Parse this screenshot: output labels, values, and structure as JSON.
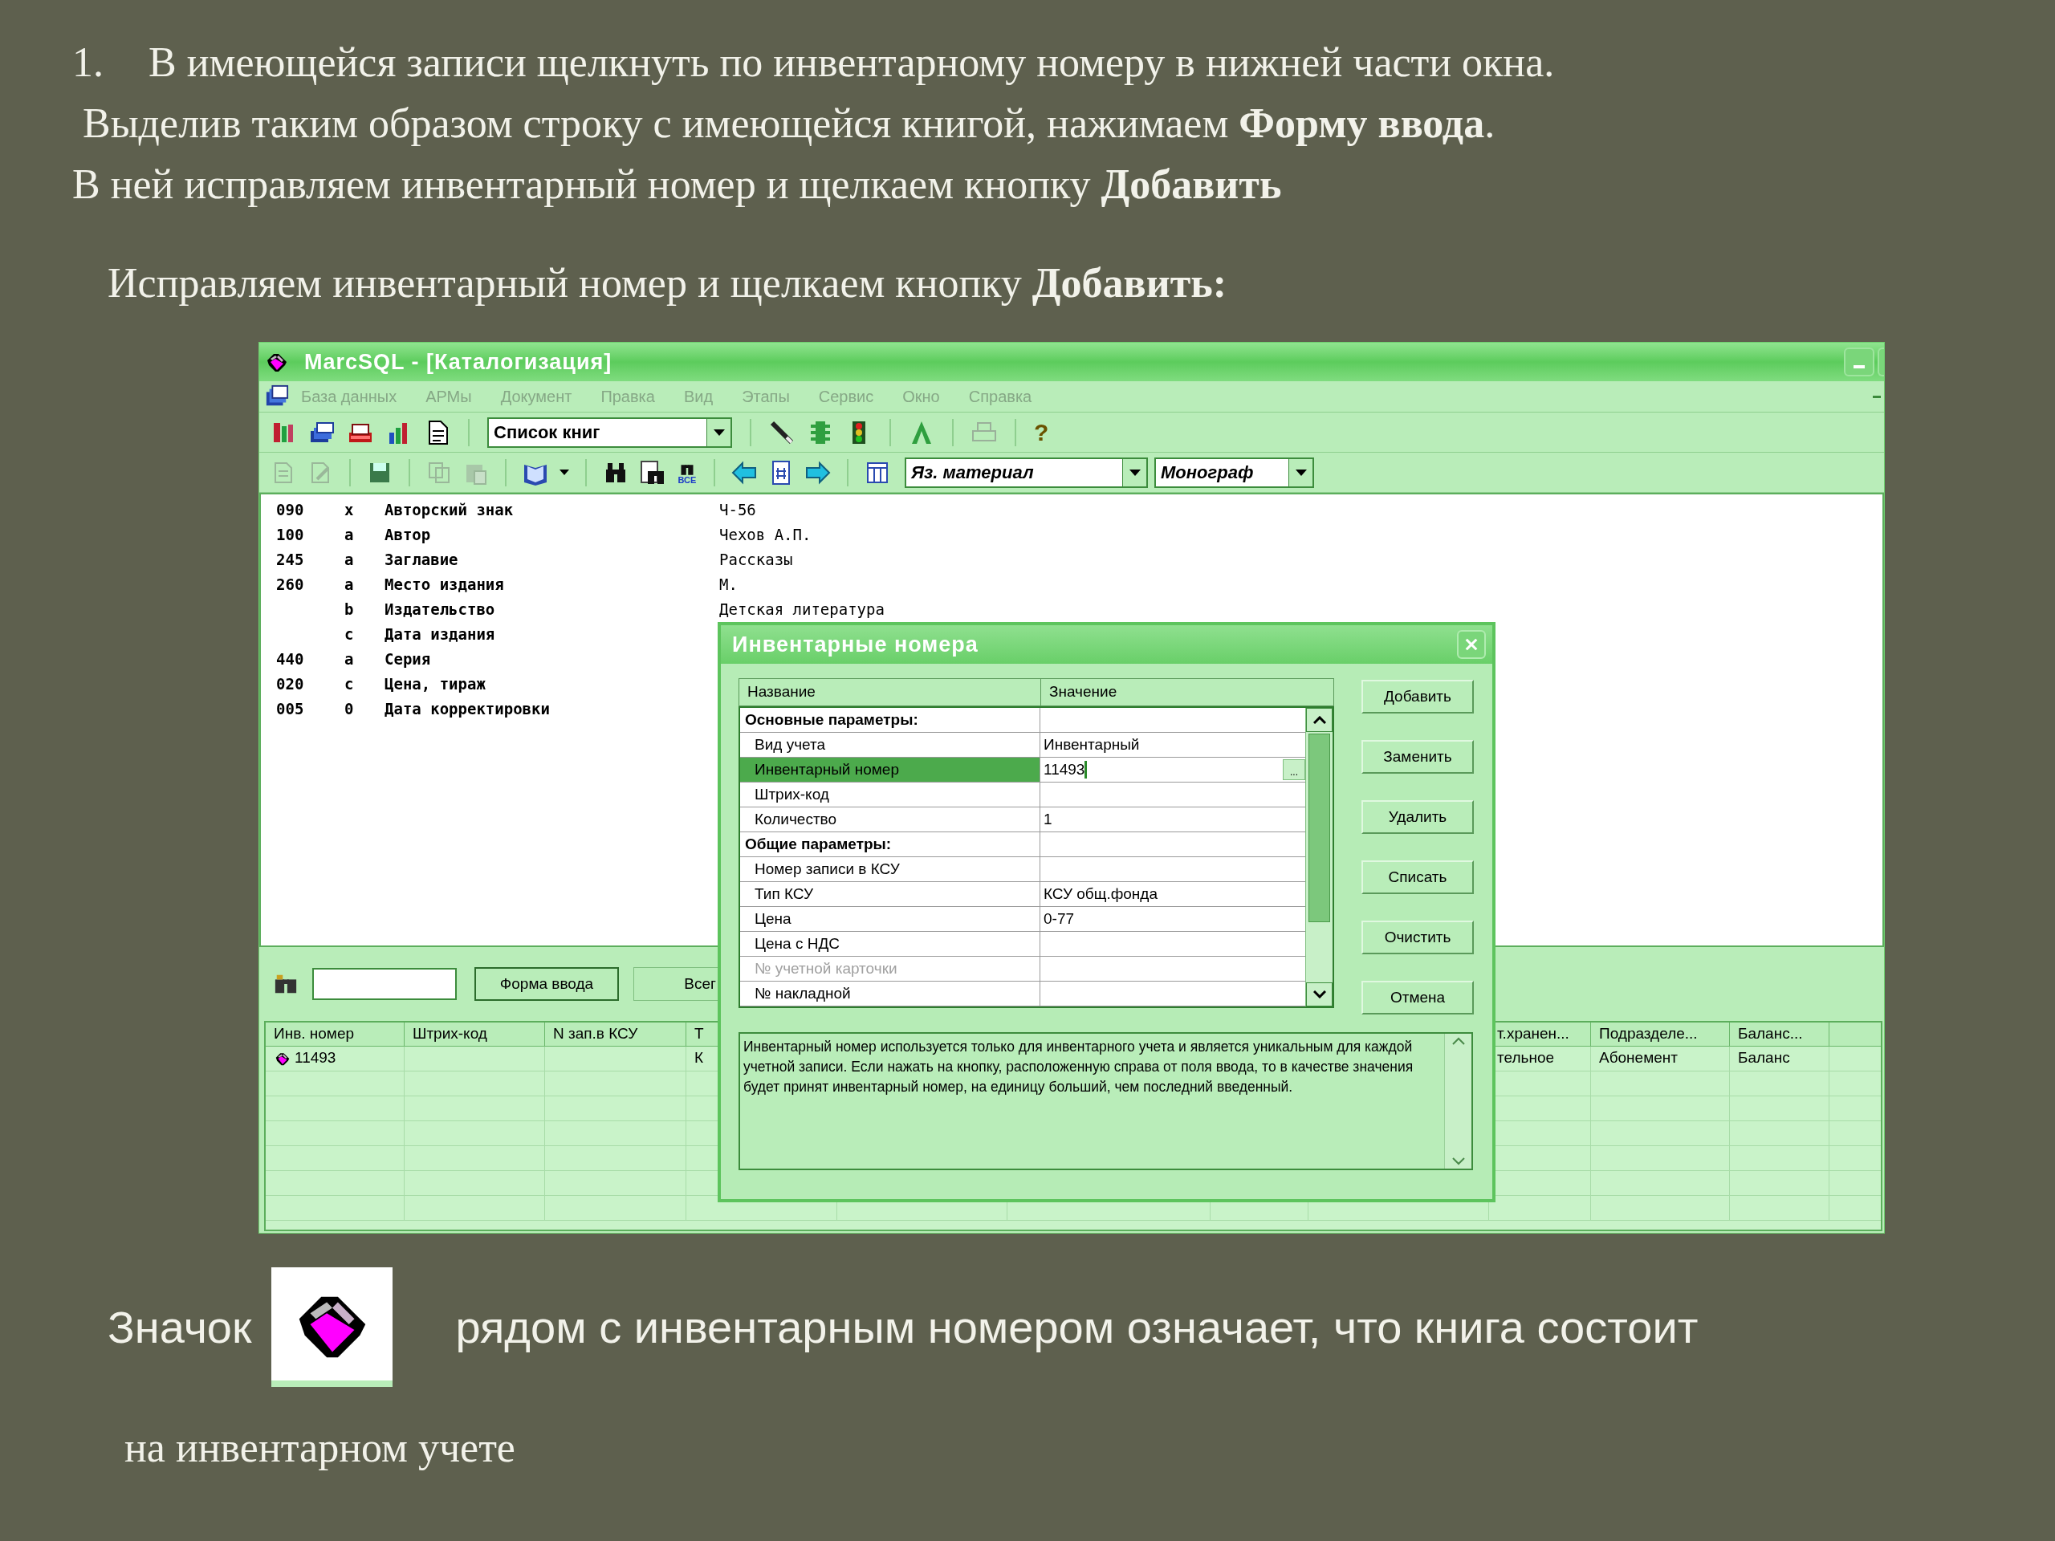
{
  "slide": {
    "step_number": "1.",
    "instructions": [
      "В имеющейся записи щелкнуть по инвентарному номеру в нижней части окна.",
      " Выделив таким образом строку с имеющейся книгой, нажимаем **Форму ввода**.",
      "В ней исправляем инвентарный номер и щелкаем кнопку **Добавить**"
    ],
    "subheading": "Исправляем инвентарный номер и щелкаем кнопку **Добавить:**",
    "caption_before_icon": "Значок",
    "caption_after_icon": "рядом с инвентарным номером означает, что книга состоит",
    "caption_last_line": "на инвентарном учете"
  },
  "window": {
    "title": "MarcSQL - [Каталогизация]",
    "menu": [
      "База данных",
      "АРМы",
      "Документ",
      "Правка",
      "Вид",
      "Этапы",
      "Сервис",
      "Окно",
      "Справка"
    ],
    "toolbar": {
      "list_dropdown": "Список книг",
      "help_glyph": "?",
      "find_all_label": "ВСЕ",
      "material_dropdown": "Яз. материал",
      "type_dropdown": "Монограф"
    },
    "record": [
      {
        "tag": "090",
        "subfield": "x",
        "name": "Авторский знак",
        "value": "Ч-56"
      },
      {
        "tag": "100",
        "subfield": "a",
        "name": "Автор",
        "value": "Чехов А.П."
      },
      {
        "tag": "245",
        "subfield": "a",
        "name": "Заглавие",
        "value": "Рассказы"
      },
      {
        "tag": "260",
        "subfield": "a",
        "name": "Место издания",
        "value": "М."
      },
      {
        "subfield": "b",
        "name": "Издательство",
        "value": "Детская литература"
      },
      {
        "subfield": "c",
        "name": "Дата издания"
      },
      {
        "tag": "440",
        "subfield": "a",
        "name": "Серия"
      },
      {
        "tag": "020",
        "subfield": "c",
        "name": "Цена, тираж"
      },
      {
        "tag": "005",
        "subfield": "0",
        "name": "Дата корректировки"
      }
    ],
    "lower_panel": {
      "buttons": [
        "Форма ввода",
        "Всег"
      ],
      "columns_left": [
        "Инв. номер",
        "Штрих-код",
        "N зап.в КСУ",
        "Т"
      ],
      "columns_right": [
        "т.хранен...",
        "Подразделе...",
        "Баланс..."
      ],
      "rows": [
        {
          "inv_number": "11493",
          "inventoried": true,
          "column_4": "К",
          "storage": "тельное",
          "department": "Абонемент",
          "balance": "Баланс"
        }
      ]
    }
  },
  "dialog": {
    "title": "Инвентарные номера",
    "grid_columns": [
      "Название",
      "Значение"
    ],
    "rows": [
      {
        "kind": "group",
        "name": "Основные параметры:",
        "selected": false,
        "disabled": false
      },
      {
        "kind": "field",
        "name": "Вид учета",
        "value": "Инвентарный",
        "selected": false,
        "disabled": false
      },
      {
        "kind": "field",
        "name": "Инвентарный номер",
        "value": "11493",
        "selected": true,
        "disabled": false
      },
      {
        "kind": "field",
        "name": "Штрих-код",
        "selected": false,
        "disabled": false
      },
      {
        "kind": "field",
        "name": "Количество",
        "value": "1",
        "selected": false,
        "disabled": false
      },
      {
        "kind": "group",
        "name": "Общие параметры:",
        "selected": false,
        "disabled": false
      },
      {
        "kind": "field",
        "name": "Номер записи в КСУ",
        "selected": false,
        "disabled": false
      },
      {
        "kind": "field",
        "name": "Тип КСУ",
        "value": "КСУ общ.фонда",
        "selected": false,
        "disabled": false
      },
      {
        "kind": "field",
        "name": "Цена",
        "value": "0-77",
        "selected": false,
        "disabled": false
      },
      {
        "kind": "field",
        "name": "Цена с НДС",
        "selected": false,
        "disabled": false
      },
      {
        "kind": "field",
        "name": "№ учетной карточки",
        "selected": false,
        "disabled": true
      },
      {
        "kind": "field",
        "name": "№ накладной",
        "selected": false,
        "disabled": false
      }
    ],
    "picker_button": "...",
    "buttons": [
      "Добавить",
      "Заменить",
      "Удалить",
      "Списать",
      "Очистить",
      "Отмена"
    ],
    "description": "Инвентарный номер используется только для инвентарного учета и является уникальным для каждой учетной записи. Если нажать на кнопку, расположенную справа от поля ввода, то в качестве значения будет принят инвентарный номер, на единицу больший, чем последний введенный."
  }
}
